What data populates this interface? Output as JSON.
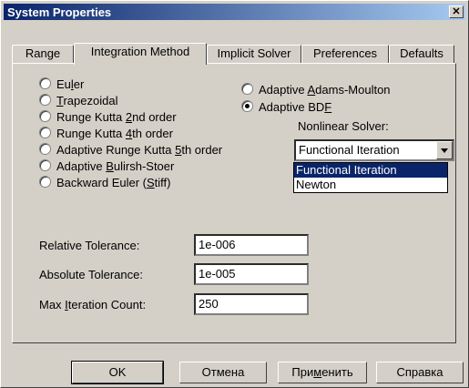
{
  "window": {
    "title": "System Properties",
    "close_glyph": "✕"
  },
  "tabs": [
    {
      "label": "Range",
      "active": false
    },
    {
      "label": "Integration Method",
      "active": true
    },
    {
      "label": "Implicit Solver",
      "active": false
    },
    {
      "label": "Preferences",
      "active": false
    },
    {
      "label": "Defaults",
      "active": false
    }
  ],
  "methods_left": [
    {
      "pre": "Eu",
      "u": "l",
      "post": "er",
      "selected": false
    },
    {
      "pre": "",
      "u": "T",
      "post": "rapezoidal",
      "selected": false
    },
    {
      "pre": "Runge Kutta ",
      "u": "2",
      "post": "nd order",
      "selected": false
    },
    {
      "pre": "Runge Kutta ",
      "u": "4",
      "post": "th order",
      "selected": false
    },
    {
      "pre": "Adaptive Runge Kutta ",
      "u": "5",
      "post": "th order",
      "selected": false
    },
    {
      "pre": "Adaptive ",
      "u": "B",
      "post": "ulirsh-Stoer",
      "selected": false
    },
    {
      "pre": "Backward Euler (",
      "u": "S",
      "post": "tiff)",
      "selected": false
    }
  ],
  "methods_right": [
    {
      "pre": "Adaptive ",
      "u": "A",
      "post": "dams-Moulton",
      "selected": false
    },
    {
      "pre": "Adaptive BD",
      "u": "F",
      "post": "",
      "selected": true
    }
  ],
  "nonlinear": {
    "label": "Nonlinear Solver:",
    "value": "Functional Iteration",
    "options": [
      "Functional Iteration",
      "Newton"
    ],
    "highlighted": "Functional Iteration"
  },
  "tolerances": {
    "relative": {
      "label": "Relative Tolerance:",
      "value": "1e-006"
    },
    "absolute": {
      "label": "Absolute Tolerance:",
      "value": "1e-005"
    },
    "max_iter": {
      "label_pre": "Max ",
      "label_u": "I",
      "label_post": "teration Count:",
      "value": "250"
    }
  },
  "buttons": {
    "ok": "OK",
    "cancel": "Отмена",
    "apply": {
      "pre": "При",
      "u": "м",
      "post": "енить"
    },
    "help": "Справка"
  }
}
